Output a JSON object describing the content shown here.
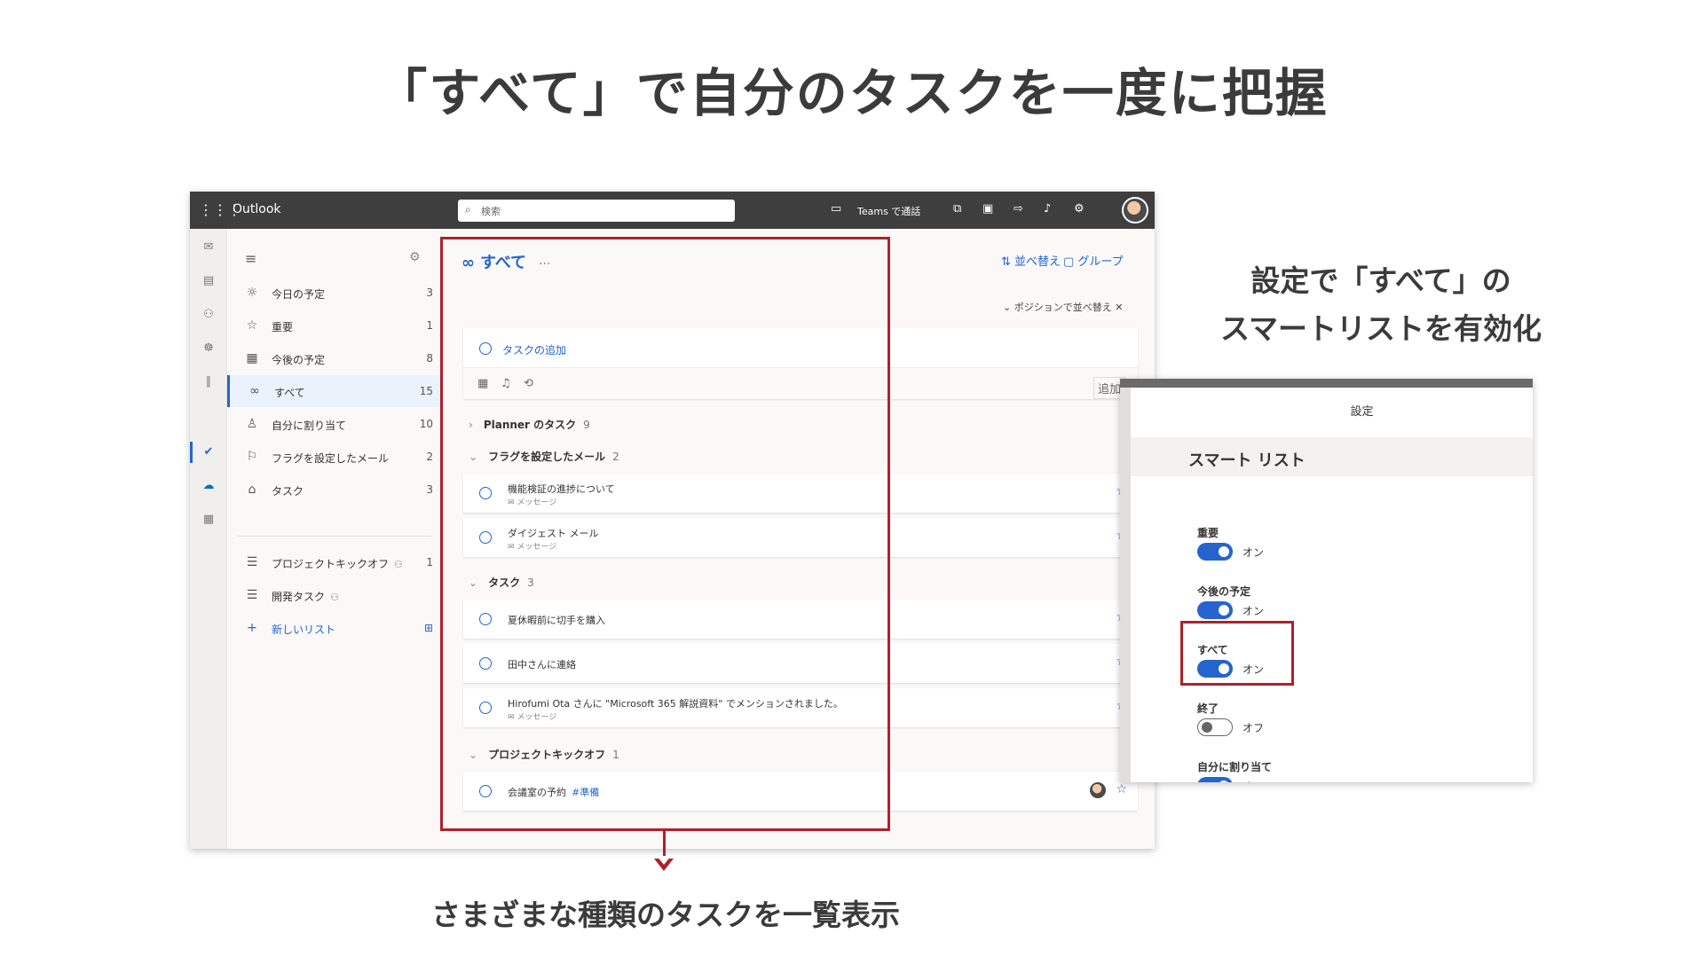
{
  "slide": {
    "title": "「すべて」で自分のタスクを一度に把握",
    "caption_right_line1": "設定で「すべて」の",
    "caption_right_line2": "スマートリストを有効化",
    "caption_bottom": "さまざまな種類のタスクを一覧表示",
    "accent_color": "#b0202a"
  },
  "topbar": {
    "waffle_icon": "waffle-icon",
    "app_name": "Outlook",
    "search_placeholder": "検索",
    "teams_label": "Teams で通話"
  },
  "nav": {
    "items": [
      {
        "icon": "☼",
        "label": "今日の予定",
        "count": "3"
      },
      {
        "icon": "☆",
        "label": "重要",
        "count": "1"
      },
      {
        "icon": "▦",
        "label": "今後の予定",
        "count": "8"
      },
      {
        "icon": "∞",
        "label": "すべて",
        "count": "15"
      },
      {
        "icon": "♙",
        "label": "自分に割り当て",
        "count": "10"
      },
      {
        "icon": "⚐",
        "label": "フラグを設定したメール",
        "count": "2"
      },
      {
        "icon": "⌂",
        "label": "タスク",
        "count": "3"
      }
    ],
    "lists": [
      {
        "label": "プロジェクトキックオフ",
        "count": "1"
      },
      {
        "label": "開発タスク",
        "count": ""
      }
    ],
    "new_list_label": "新しいリスト"
  },
  "main": {
    "title": "すべて",
    "sort_label": "並べ替え",
    "group_label": "グループ",
    "sort_chip": "ポジションで並べ替え",
    "add_task": "タスクの追加",
    "add_button": "追加",
    "groups": [
      {
        "name": "Planner のタスク",
        "count": "9"
      },
      {
        "name": "フラグを設定したメール",
        "count": "2"
      },
      {
        "name": "タスク",
        "count": "3"
      },
      {
        "name": "プロジェクトキックオフ",
        "count": "1"
      }
    ],
    "tasks": [
      {
        "title": "機能検証の進捗について",
        "sub": "メッセージ"
      },
      {
        "title": "ダイジェスト メール",
        "sub": "メッセージ"
      },
      {
        "title": "夏休暇前に切手を購入",
        "sub": ""
      },
      {
        "title": "田中さんに連絡",
        "sub": ""
      },
      {
        "title": "Hirofumi Ota さんに \"Microsoft 365 解説資料\" でメンションされました。",
        "sub": "メッセージ"
      },
      {
        "title": "会議室の予約",
        "tag": "#準備"
      }
    ]
  },
  "settings": {
    "title": "設定",
    "section": "スマート リスト",
    "options": [
      {
        "label": "重要",
        "state": "オン"
      },
      {
        "label": "今後の予定",
        "state": "オン"
      },
      {
        "label": "すべて",
        "state": "オン"
      },
      {
        "label": "終了",
        "state": "オフ"
      },
      {
        "label": "自分に割り当て",
        "state": "オン"
      }
    ]
  }
}
